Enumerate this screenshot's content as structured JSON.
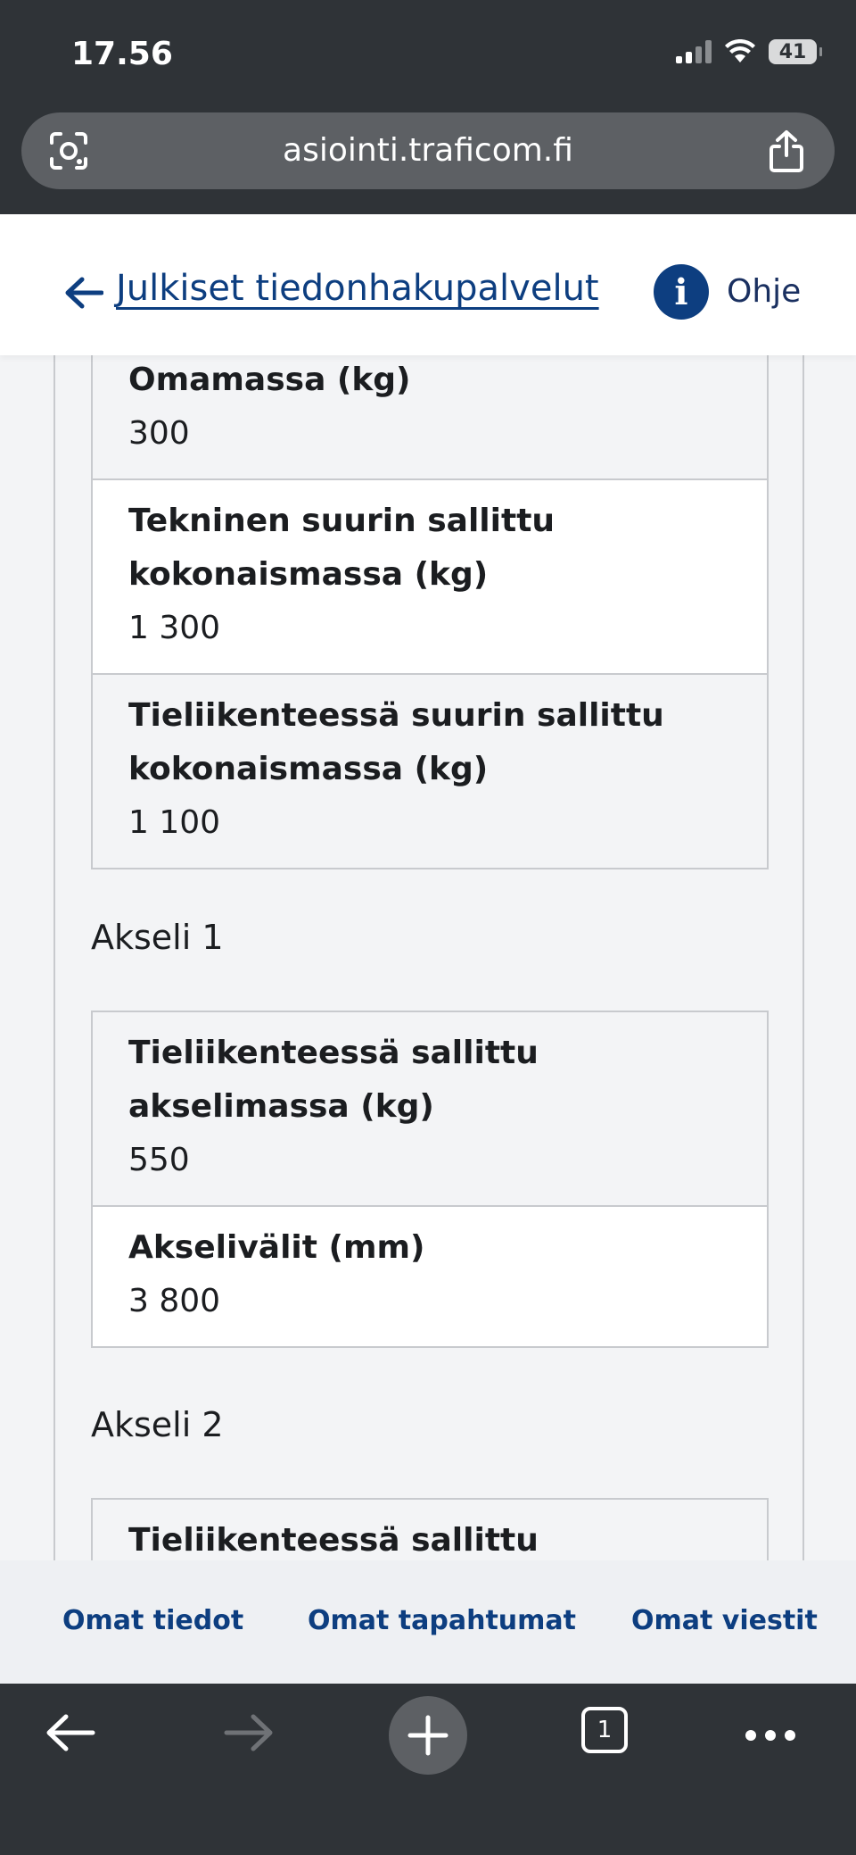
{
  "status_bar": {
    "time": "17.56",
    "battery": "41"
  },
  "browser": {
    "url": "asiointi.traficom.fi"
  },
  "header": {
    "back_label": "Julkiset tiedonhakupalvelut",
    "help_label": "Ohje"
  },
  "table1": {
    "rows": [
      {
        "label": "Omamassa (kg)",
        "value": "300"
      },
      {
        "label": "Tekninen suurin sallittu kokonaismassa (kg)",
        "value": "1 300"
      },
      {
        "label": "Tieliikenteessä suurin sallittu kokonaismassa (kg)",
        "value": "1 100"
      }
    ]
  },
  "axle1": {
    "title": "Akseli 1",
    "rows": [
      {
        "label": "Tieliikenteessä sallittu akselimassa (kg)",
        "value": "550"
      },
      {
        "label": "Akselivälit (mm)",
        "value": "3 800"
      }
    ]
  },
  "axle2": {
    "title": "Akseli 2",
    "rows": [
      {
        "label": "Tieliikenteessä sallittu"
      }
    ]
  },
  "bottom_nav": {
    "items": [
      "Omat tiedot",
      "Omat tapahtumat",
      "Omat viestit"
    ]
  },
  "toolbar": {
    "tab_count": "1"
  },
  "colors": {
    "brand": "#0d3e80",
    "browser_chrome": "#2f3337"
  }
}
